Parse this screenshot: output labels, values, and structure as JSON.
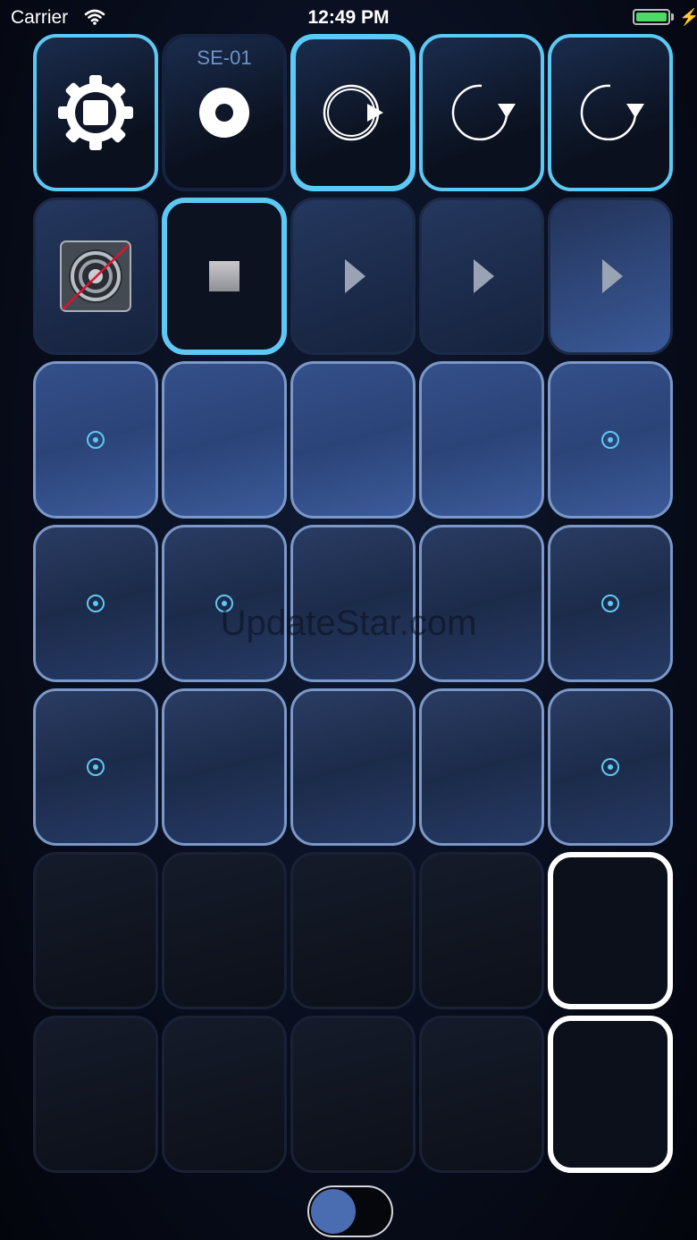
{
  "status_bar": {
    "carrier": "Carrier",
    "time": "12:49 PM",
    "battery_level_pct": 100,
    "battery_color": "#4cd964"
  },
  "colors": {
    "accent": "#5ec8f5",
    "clip_border": "#7b98c9",
    "highlight_border": "#ffffff"
  },
  "controls": {
    "stop_all_icon": "gear-stop-icon",
    "record_label": "SE-01",
    "record_icon": "record-icon",
    "loop_icons": [
      "loop-play-icon",
      "loop-icon",
      "loop-icon"
    ]
  },
  "row2": {
    "mute_icon": "speaker-muted-icon",
    "stop_icon": "stop-icon",
    "play_icons": [
      "play-icon",
      "play-icon",
      "play-icon"
    ]
  },
  "watermark": "UpdateStar.com",
  "toggle": {
    "on": false
  }
}
